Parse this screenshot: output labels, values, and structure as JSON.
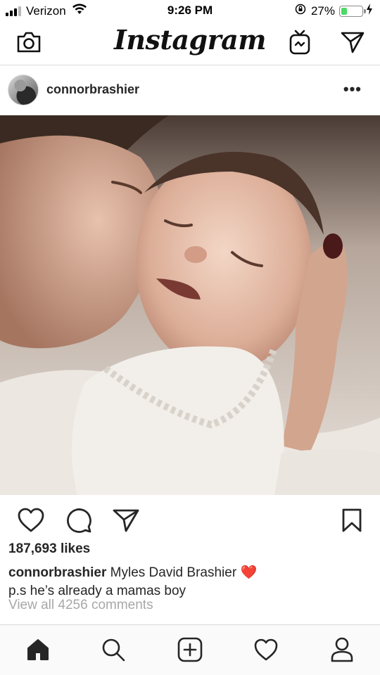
{
  "status_bar": {
    "carrier": "Verizon",
    "time": "9:26 PM",
    "battery_percent": "27%",
    "battery_level": 0.27,
    "battery_color": "#4cd964"
  },
  "header": {
    "logo_text": "Instagram",
    "icons": [
      "camera-icon",
      "igtv-icon",
      "direct-message-icon"
    ]
  },
  "post": {
    "username": "connorbrashier",
    "more_label": "•••",
    "photo_icon": "photo-mother-kissing-baby",
    "actions": [
      "like-heart-icon",
      "comment-icon",
      "share-icon",
      "bookmark-icon"
    ],
    "likes": "187,693 likes",
    "caption_username": "connorbrashier",
    "caption_text": "Myles David Brashier",
    "caption_emoji": "❤️",
    "caption_line2": "p.s he’s already a mamas boy",
    "view_all_comments": "View all 4256 comments"
  },
  "tabbar": {
    "items": [
      "home-icon",
      "search-icon",
      "new-post-icon",
      "activity-icon",
      "profile-icon"
    ]
  },
  "colors": {
    "text": "#262626",
    "muted": "#a8a8a8",
    "divider": "#dbdbdb",
    "heart": "#e0245e"
  }
}
